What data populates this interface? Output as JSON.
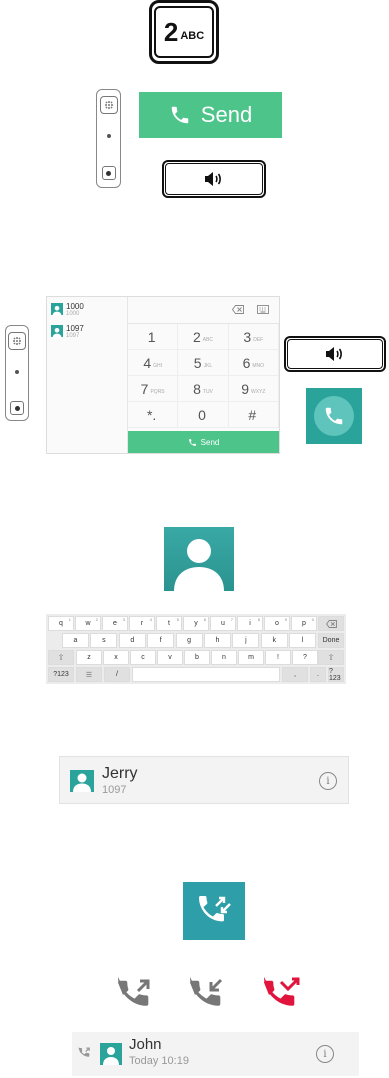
{
  "key_two": {
    "digit": "2",
    "letters": "ABC",
    "icon": "digit-key-icon"
  },
  "send_bar": {
    "label": "Send",
    "icon": "phone-icon",
    "color": "#4dc48a"
  },
  "speaker_icon": "speaker-icon",
  "dialer": {
    "contacts": [
      {
        "name": "1000",
        "number": "1000"
      },
      {
        "name": "1097",
        "number": "1097"
      }
    ],
    "keys": [
      {
        "main": "1",
        "sub": ""
      },
      {
        "main": "2",
        "sub": "ABC"
      },
      {
        "main": "3",
        "sub": "DEF"
      },
      {
        "main": "4",
        "sub": "GHI"
      },
      {
        "main": "5",
        "sub": "JKL"
      },
      {
        "main": "6",
        "sub": "MNO"
      },
      {
        "main": "7",
        "sub": "PQRS"
      },
      {
        "main": "8",
        "sub": "TUV"
      },
      {
        "main": "9",
        "sub": "WXYZ"
      },
      {
        "main": "*.",
        "sub": ""
      },
      {
        "main": "0",
        "sub": ""
      },
      {
        "main": "#",
        "sub": ""
      }
    ],
    "send_label": "Send"
  },
  "accent_color": "#2aa39a",
  "keyboard": {
    "row1": [
      {
        "k": "q",
        "n": "1"
      },
      {
        "k": "w",
        "n": "2"
      },
      {
        "k": "e",
        "n": "3"
      },
      {
        "k": "r",
        "n": "4"
      },
      {
        "k": "t",
        "n": "5"
      },
      {
        "k": "y",
        "n": "6"
      },
      {
        "k": "u",
        "n": "7"
      },
      {
        "k": "i",
        "n": "8"
      },
      {
        "k": "o",
        "n": "9"
      },
      {
        "k": "p",
        "n": "0"
      }
    ],
    "row2": [
      "a",
      "s",
      "d",
      "f",
      "g",
      "h",
      "j",
      "k",
      "l"
    ],
    "done": "Done",
    "row3": [
      "z",
      "x",
      "c",
      "v",
      "b",
      "n",
      "m",
      "!",
      "?"
    ],
    "sym": "?123",
    "slash": "/",
    "comma": ",",
    "period": "."
  },
  "contact_row": {
    "name": "Jerry",
    "number": "1097",
    "info": "i"
  },
  "history_icons": [
    "call-history-icon",
    "outgoing-call-icon",
    "incoming-call-icon",
    "missed-call-icon"
  ],
  "missed_color": "#e0143c",
  "history_row": {
    "name": "John",
    "time": "Today 10:19",
    "info": "i"
  }
}
